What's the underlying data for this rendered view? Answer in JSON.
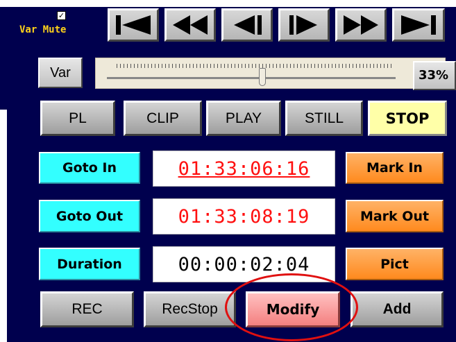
{
  "transport": {
    "var_mute_label": "Var Mute",
    "var_mute_checked": "✓",
    "buttons": [
      {
        "name": "go-to-start-button",
        "icon": "skip-to-start-icon"
      },
      {
        "name": "fast-rewind-button",
        "icon": "fast-rewind-icon"
      },
      {
        "name": "step-back-button",
        "icon": "step-back-icon"
      },
      {
        "name": "step-forward-button",
        "icon": "step-forward-icon"
      },
      {
        "name": "fast-forward-button",
        "icon": "fast-forward-icon"
      },
      {
        "name": "go-to-end-button",
        "icon": "skip-to-end-icon"
      }
    ]
  },
  "var_row": {
    "var_label": "Var",
    "zoom_label": "33%",
    "slider_value": 0.33
  },
  "modes": {
    "pl": "PL",
    "clip": "CLIP",
    "play": "PLAY",
    "still": "STILL",
    "stop": "STOP",
    "active": "STOP"
  },
  "timecodes": {
    "goto_in_label": "Goto In",
    "in_value": "01:33:06:16",
    "mark_in_label": "Mark In",
    "goto_out_label": "Goto Out",
    "out_value": "01:33:08:19",
    "mark_out_label": "Mark Out",
    "duration_label": "Duration",
    "duration_value": "00:00:02:04",
    "pict_label": "Pict"
  },
  "actions": {
    "rec": "REC",
    "recstop": "RecStop",
    "modify": "Modify",
    "add": "Add"
  },
  "colors": {
    "panel": "#00004e",
    "mute_label": "#ffd21a",
    "timecode_red": "#ff1010",
    "highlight_ellipse": "#e01010"
  }
}
